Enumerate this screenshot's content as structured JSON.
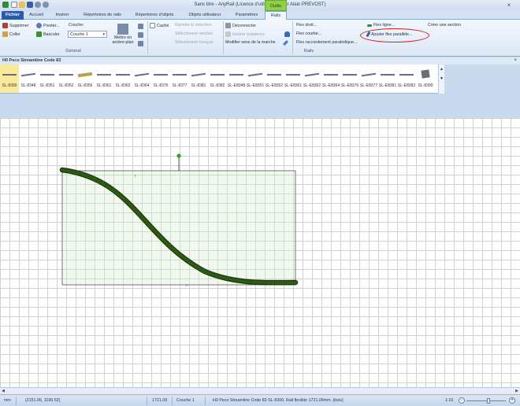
{
  "window": {
    "title": "Sans titre - AnyRail (Licence d'utilisation pour Alain PREVOST)",
    "context_tab_group": "Outils",
    "close_symbol": "×"
  },
  "quick_access": [
    "app-icon",
    "new-icon",
    "open-icon",
    "save-icon",
    "undo-icon",
    "redo-icon"
  ],
  "tabs": [
    {
      "label": "Fichier",
      "active": false
    },
    {
      "label": "Accueil",
      "active": false
    },
    {
      "label": "Insérer",
      "active": false
    },
    {
      "label": "Répertoires de rails",
      "active": false
    },
    {
      "label": "Répertoires d'objets",
      "active": false
    },
    {
      "label": "Objets utilisateur",
      "active": false
    },
    {
      "label": "Paramètres",
      "active": false
    },
    {
      "label": "Rails",
      "active": true
    }
  ],
  "ribbon": {
    "general": {
      "delete": "Supprimer",
      "paste": "Coller",
      "pivot": "Pivoter...",
      "flip": "Basculer",
      "layer_label": "Couche:",
      "layer_value": "Couche 1",
      "bring_back": "Mettre en arrière-plan",
      "label": "Général"
    },
    "selection": {
      "hidden": "Caché",
      "extend": "Étendre la sélection",
      "select_section": "Sélectionner section",
      "select_segment": "Sélectionner tronçon"
    },
    "connect": {
      "disconnect": "Déconnecter",
      "insert_insulators": "Insérer isolateurs",
      "change_direction": "Modifier sens de la marche"
    },
    "rails": {
      "flex_straight": "Flex droit...",
      "flex_curved": "Flex courbe...",
      "flex_parabolic": "Flex raccordement parabolique...",
      "flex_line": "Flex ligne...",
      "add_parallel_flex": "Ajouter flex parallèle...",
      "create_section": "Créer une section",
      "label": "Rails"
    },
    "highlight_color": "#d21f1f"
  },
  "library": {
    "title": "H0 Peco Streamline Code 83",
    "close_symbol": "×",
    "items": [
      "SL-8300",
      "SL-8348",
      "SL-8351",
      "SL-8352",
      "SL-8356",
      "SL-8361",
      "SL-8362",
      "SL-8364",
      "SL-8376",
      "SL-8377",
      "SL-8381",
      "SL-8382",
      "SL-E8348",
      "SL-E8351",
      "SL-E8352",
      "SL-E8361",
      "SL-E8362",
      "SL-E8364",
      "SL-E8376",
      "SL-E8377",
      "SL-E8381",
      "SL-E8382",
      "SL-8390"
    ],
    "selected_index": 0,
    "scroll_up": "▲",
    "scroll_down": "▼"
  },
  "canvas": {
    "track_color": "#2d5a14",
    "handle_color": "#2e9e2e"
  },
  "scrollbar": {
    "left": "◀",
    "right": "▶"
  },
  "status": {
    "unit": "mm",
    "coordinates": "(2151.06, 1199.52)",
    "length": "1721.09",
    "layer": "Couche 1",
    "description": "H0 Peco Streamline Code 83 SL-8300. Rail flexible 1721.09mm. (bois)",
    "scale": "1:10",
    "zoom_minus": "−",
    "zoom_plus": "+",
    "zoom_level": 0.55
  }
}
